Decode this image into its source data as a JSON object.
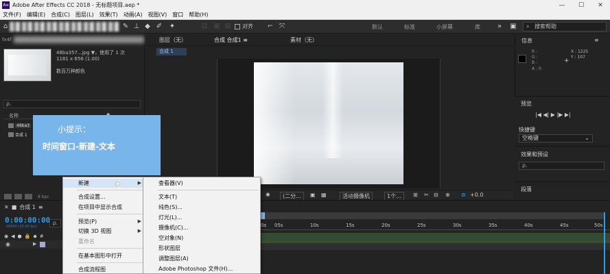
{
  "window": {
    "title": "Adobe After Effects CC 2018 - 无标题项目.aep *",
    "app_icon": "Ae",
    "controls": [
      "minimize-icon",
      "maximize-icon",
      "close-icon"
    ]
  },
  "menubar": [
    "文件(F)",
    "编辑(E)",
    "合成(C)",
    "图层(L)",
    "效果(T)",
    "动画(A)",
    "视图(V)",
    "窗口",
    "帮助(H)"
  ],
  "toolbar": {
    "snap_label": "对齐",
    "workspaces": [
      "默认",
      "标准",
      "小屏幕",
      "库"
    ],
    "search_placeholder": "搜索帮助"
  },
  "project": {
    "panel_name": "fx4f",
    "file_name": "48ba357...jpg ▼",
    "file_usage": "，使用了 1 次",
    "file_dims": "1181 x 656 (1.00)",
    "file_color": "数百万种颜色",
    "search": "ρ.",
    "col_name": "名称",
    "rows": [
      {
        "label": "48ba3"
      },
      {
        "label": "合成 1"
      }
    ],
    "bpc": "8 bpc"
  },
  "tip": {
    "line1": "小提示：",
    "line2": "时间窗口-新建-文本"
  },
  "viewer": {
    "tabs": [
      "图层（无）",
      "合成 合成1 ≡",
      "素材（无）"
    ],
    "subtab": "合成 1",
    "bottom": {
      "res": "(二分...",
      "camera": "活动摄像机",
      "views": "1个...",
      "offset": "+0.0"
    }
  },
  "info": {
    "title": "信息",
    "r": "R :",
    "g": "G :",
    "b": "B :",
    "a": "A : 0",
    "x": "X : 1225",
    "y": "Y : 107"
  },
  "preview": {
    "title": "预览",
    "controls": "|◀ ◀| ▶ |▶ ▶|",
    "shortcut_label": "快捷键",
    "shortcut_value": "空格键"
  },
  "effects": {
    "title": "效果和预设",
    "search": "ρ.",
    "paragraph": "段落"
  },
  "timeline": {
    "tab": "合成 1",
    "timecode": "0:00:00:00",
    "fps": "00000 (25.00 fps)",
    "ruler": [
      "0s",
      "05s",
      "10s",
      "15s",
      "20s",
      "25s",
      "30s",
      "35s",
      "40s",
      "45s",
      "50s"
    ]
  },
  "context_menu": {
    "items": [
      {
        "label": "新建",
        "arrow": "▶",
        "highlight": true
      },
      {
        "label": "合成设置..."
      },
      {
        "label": "在项目中显示合成"
      },
      {
        "label": "预览(P)",
        "arrow": "▶"
      },
      {
        "label": "切换 3D 视图",
        "arrow": "▶"
      },
      {
        "label": "重命名",
        "disabled": true
      },
      {
        "label": "在基本图形中打开"
      },
      {
        "label": "合成流程图"
      }
    ]
  },
  "submenu": {
    "items": [
      {
        "label": "查看器(V)"
      },
      {
        "label": "文本(T)"
      },
      {
        "label": "纯色(S)..."
      },
      {
        "label": "灯光(L)..."
      },
      {
        "label": "摄像机(C)..."
      },
      {
        "label": "空对象(N)"
      },
      {
        "label": "形状图层"
      },
      {
        "label": "调整图层(A)"
      },
      {
        "label": "Adobe Photoshop 文件(H)..."
      }
    ]
  }
}
